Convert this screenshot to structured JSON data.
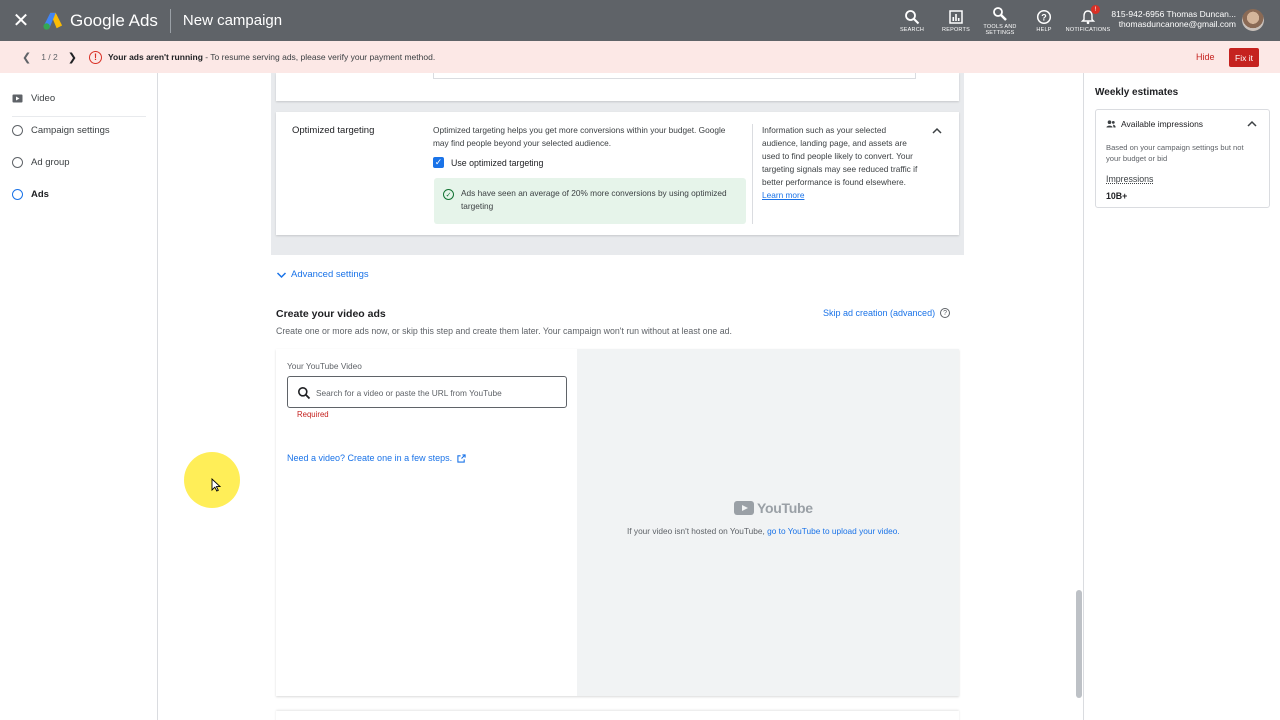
{
  "header": {
    "brand": "Google Ads",
    "page_title": "New campaign",
    "actions": [
      {
        "label": "SEARCH",
        "icon": "search-icon"
      },
      {
        "label": "REPORTS",
        "icon": "reports-icon"
      },
      {
        "label": "TOOLS AND SETTINGS",
        "icon": "wrench-icon"
      },
      {
        "label": "HELP",
        "icon": "help-icon"
      },
      {
        "label": "NOTIFICATIONS",
        "icon": "bell-icon"
      }
    ],
    "notification_badge": "!",
    "account_line1": "815-942-6956 Thomas Duncan...",
    "account_email": "thomasduncanone@gmail.com"
  },
  "alert": {
    "pager": "1 / 2",
    "bold_text": "Your ads aren't running",
    "text": " - To resume serving ads, please verify your payment method.",
    "hide_label": "Hide",
    "fix_label": "Fix it",
    "color": "#c5221f"
  },
  "leftnav": {
    "items": [
      {
        "label": "Video",
        "icon": "video-icon"
      },
      {
        "label": "Campaign settings"
      },
      {
        "label": "Ad group"
      },
      {
        "label": "Ads"
      }
    ]
  },
  "optimized": {
    "title": "Optimized targeting",
    "description": "Optimized targeting helps you get more conversions within your budget. Google may find people beyond your selected audience.",
    "checkbox_label": "Use optimized targeting",
    "note": "Ads have seen an average of 20% more conversions by using optimized targeting",
    "info": "Information such as your selected audience, landing page, and assets are used to find people likely to convert. Your targeting signals may see reduced traffic if better performance is found elsewhere.",
    "learn_more": "Learn more"
  },
  "advanced_settings": "Advanced settings",
  "create": {
    "title": "Create your video ads",
    "description": "Create one or more ads now, or skip this step and create them later. Your campaign won't run without at least one ad.",
    "skip_link": "Skip ad creation (advanced)"
  },
  "video": {
    "label": "Your YouTube Video",
    "search_placeholder": "Search for a video or paste the URL from YouTube",
    "required": "Required",
    "need_video": "Need a video? Create one in a few steps.",
    "youtube_logo": "YouTube",
    "note_text": "If your video isn't hosted on YouTube, ",
    "note_link": "go to YouTube to upload your video."
  },
  "right_panel": {
    "title": "Weekly estimates",
    "card_title": "Available impressions",
    "card_desc": "Based on your campaign settings but not your budget or bid",
    "impressions_label": "Impressions",
    "impressions_value": "10B+"
  },
  "colors": {
    "header_bg": "#5f6368",
    "alert_bg": "#fce8e6",
    "accent": "#1a73e8"
  }
}
